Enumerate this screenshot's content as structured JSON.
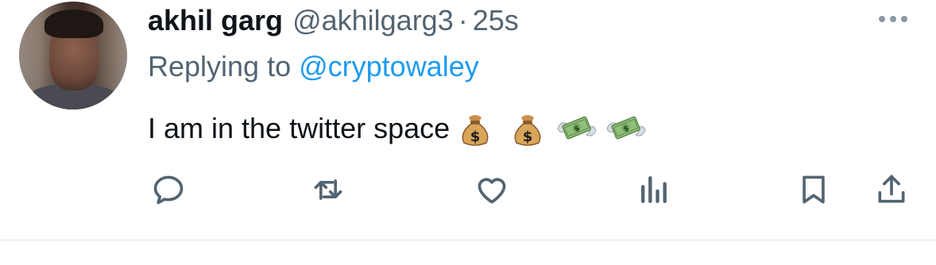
{
  "tweet": {
    "author_name": "akhil garg",
    "author_handle": "@akhilgarg3",
    "separator": "·",
    "time": "25s",
    "replying_prefix": "Replying to",
    "replying_to": "@cryptowaley",
    "text": "I am in the twitter space",
    "emojis": [
      "money-bag",
      "money-bag",
      "money-with-wings",
      "money-with-wings"
    ]
  },
  "icons": {
    "more": "more-dots-icon",
    "reply": "reply-bubble-icon",
    "retweet": "retweet-icon",
    "like": "heart-icon",
    "views": "views-bar-chart-icon",
    "bookmark": "bookmark-icon",
    "share": "share-upload-icon"
  },
  "colors": {
    "text": "#0f1419",
    "secondary": "#536471",
    "link": "#1d9bf0",
    "icon": "#536471"
  }
}
